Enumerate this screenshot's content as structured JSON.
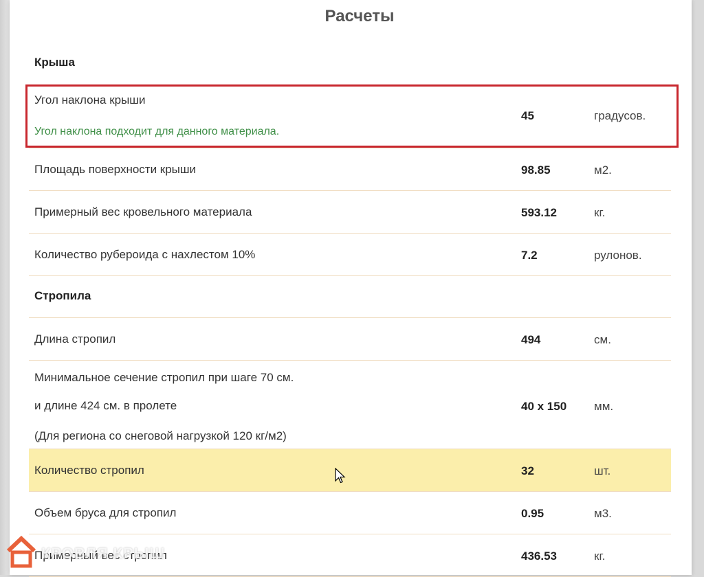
{
  "page": {
    "title": "Расчеты"
  },
  "roof": {
    "section_title": "Крыша",
    "angle": {
      "label": "Угол наклона крыши",
      "note": "Угол наклона подходит для данного материала.",
      "value": "45",
      "unit": "градусов."
    },
    "area": {
      "label": "Площадь поверхности крыши",
      "value": "98.85",
      "unit": "м2."
    },
    "weight": {
      "label": "Примерный вес кровельного материала",
      "value": "593.12",
      "unit": "кг."
    },
    "ruberoid": {
      "label": "Количество рубероида с нахлестом 10%",
      "value": "7.2",
      "unit": "рулонов."
    }
  },
  "rafters": {
    "section_title": "Стропила",
    "length": {
      "label": "Длина стропил",
      "value": "494",
      "unit": "см."
    },
    "section": {
      "line1": "Минимальное сечение стропил при шаге 70 см.",
      "line2": "и длине 424 см. в пролете",
      "line3": "(Для региона со снеговой нагрузкой 120 кг/м2)",
      "value": "40 х 150",
      "unit": "мм."
    },
    "count": {
      "label": "Количество стропил",
      "value": "32",
      "unit": "шт."
    },
    "volume": {
      "label": "Объем бруса для стропил",
      "value": "0.95",
      "unit": "м3."
    },
    "weight": {
      "label": "Примерный вес стропил",
      "value": "436.53",
      "unit": "кг."
    }
  },
  "watermark": {
    "text": "КРОВЛЯ КРЫШ"
  },
  "colors": {
    "highlight_row": "#fbeeab",
    "alert_border": "#c8262d",
    "ok_text": "#3f8f47"
  }
}
